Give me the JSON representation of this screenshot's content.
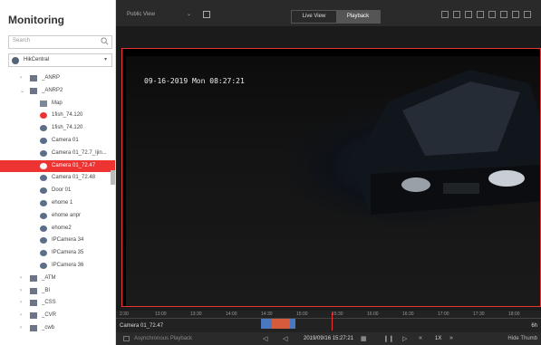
{
  "sidebar": {
    "title": "Monitoring",
    "search_placeholder": "Search",
    "site": "HikCentral",
    "tree": [
      {
        "label": "_ANRP",
        "kind": "group",
        "level": 1,
        "expanded": false
      },
      {
        "label": "_ANRP2",
        "kind": "group",
        "level": 1,
        "expanded": true
      },
      {
        "label": "Map",
        "kind": "map",
        "level": 2
      },
      {
        "label": "1fish_74.120",
        "kind": "camera-red",
        "level": 2
      },
      {
        "label": "1fish_74.120",
        "kind": "camera",
        "level": 2
      },
      {
        "label": "Camera 01",
        "kind": "camera",
        "level": 2
      },
      {
        "label": "Camera 01_72.7_Ijin...",
        "kind": "camera",
        "level": 2
      },
      {
        "label": "Camera 01_72.47",
        "kind": "camera",
        "level": 2,
        "selected": true
      },
      {
        "label": "Camera 01_72.48",
        "kind": "camera",
        "level": 2
      },
      {
        "label": "Door 01",
        "kind": "camera",
        "level": 2
      },
      {
        "label": "ehome 1",
        "kind": "camera",
        "level": 2
      },
      {
        "label": "ehome anpr",
        "kind": "camera",
        "level": 2
      },
      {
        "label": "ehome2",
        "kind": "camera",
        "level": 2
      },
      {
        "label": "IPCamera 34",
        "kind": "camera",
        "level": 2
      },
      {
        "label": "IPCamera 35",
        "kind": "camera",
        "level": 2
      },
      {
        "label": "IPCamera 36",
        "kind": "camera",
        "level": 2
      },
      {
        "label": "_ATM",
        "kind": "group",
        "level": 1,
        "expanded": false
      },
      {
        "label": "_BI",
        "kind": "group",
        "level": 1,
        "expanded": false
      },
      {
        "label": "_CSS",
        "kind": "group",
        "level": 1,
        "expanded": false
      },
      {
        "label": "_CVR",
        "kind": "group",
        "level": 1,
        "expanded": false
      },
      {
        "label": "_cwb",
        "kind": "group",
        "level": 1,
        "expanded": false
      }
    ]
  },
  "topbar": {
    "view_name": "Public View",
    "tabs": [
      "Live View",
      "Playback"
    ],
    "active_tab": "Playback"
  },
  "player": {
    "osd_text": "09-16-2019 Mon 08:27:21",
    "camera_tag": "Camera 01_72.47"
  },
  "timeline": {
    "labels": [
      "2:30",
      "13:00",
      "13:30",
      "14:00",
      "14:30",
      "15:00",
      "15:30",
      "16:00",
      "16:30",
      "17:00",
      "17:30",
      "18:00"
    ],
    "right_label": "6h"
  },
  "bottombar": {
    "async_label": "Asynchronous Playback",
    "datetime": "2019/09/16 15:27:21",
    "speed": "1X",
    "hide_label": "Hide Thumb"
  },
  "colors": {
    "accent": "#e33333",
    "sidebar_bg": "#ffffff",
    "main_bg": "#1b1b1b"
  }
}
